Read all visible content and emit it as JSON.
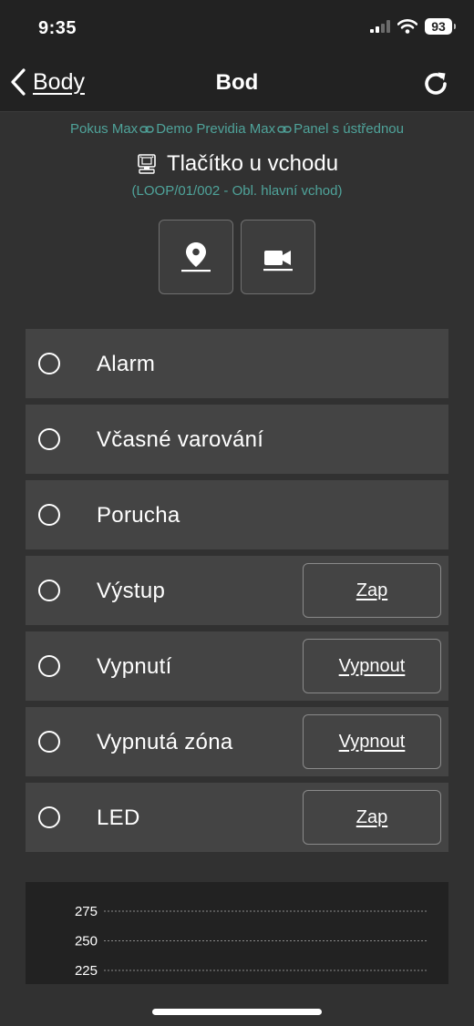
{
  "status_bar": {
    "time": "9:35",
    "battery": "93"
  },
  "nav": {
    "back_label": "Body",
    "title": "Bod"
  },
  "breadcrumb": [
    "Pokus Max",
    "Demo Previdia Max",
    "Panel s ústřednou"
  ],
  "device": {
    "name": "Tlačítko u vchodu",
    "subtitle": "(LOOP/01/002 - Obl. hlavní vchod)"
  },
  "states": [
    {
      "label": "Alarm",
      "button": null
    },
    {
      "label": "Včasné varování",
      "button": null
    },
    {
      "label": "Porucha",
      "button": null
    },
    {
      "label": "Výstup",
      "button": "Zap"
    },
    {
      "label": "Vypnutí",
      "button": "Vypnout"
    },
    {
      "label": "Vypnutá zóna",
      "button": "Vypnout"
    },
    {
      "label": "LED",
      "button": "Zap"
    }
  ],
  "colors": {
    "accent": "#4fa39a",
    "background": "#313131",
    "row": "#444444",
    "bar": "#222222"
  },
  "chart_data": {
    "type": "line",
    "y_ticks": [
      275,
      250,
      225
    ],
    "grid": true
  }
}
